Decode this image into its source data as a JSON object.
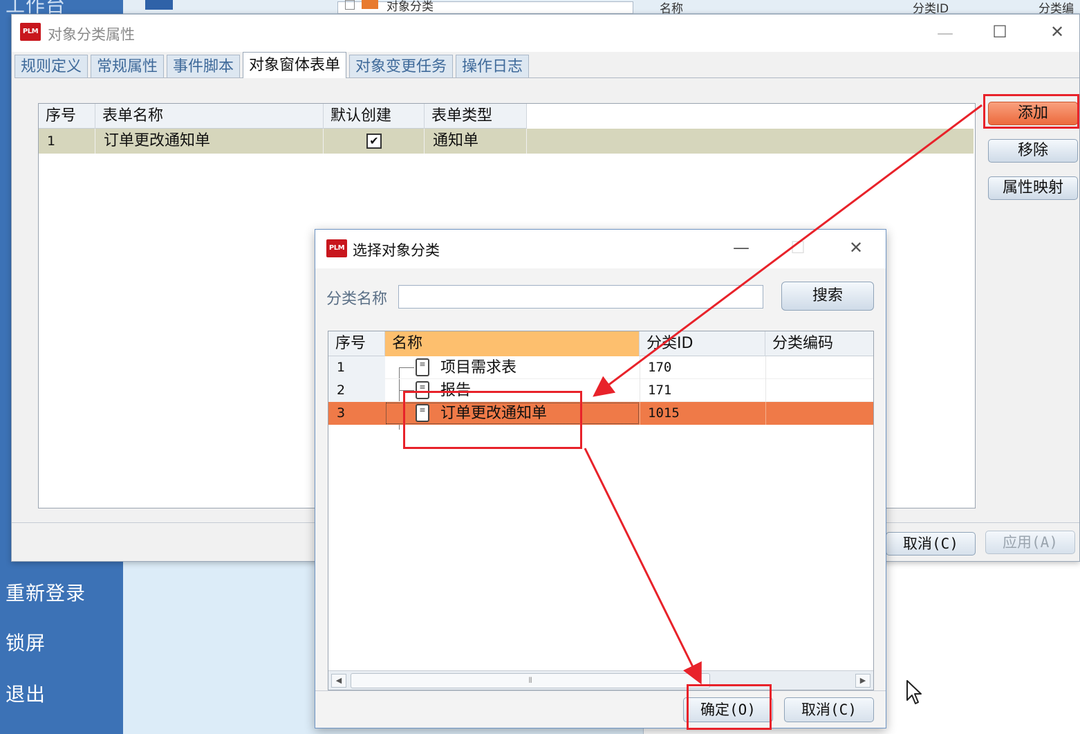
{
  "background": {
    "top_tab_title": "工作台",
    "top_panel_header": "对象分类",
    "top_grid_headers": [
      "名称",
      "分类ID",
      "分类编"
    ],
    "sidebar": [
      "重新登录",
      "锁屏",
      "退出"
    ]
  },
  "props_dialog": {
    "logo": "PLM",
    "title": "对象分类属性",
    "tabs": [
      "规则定义",
      "常规属性",
      "事件脚本",
      "对象窗体表单",
      "对象变更任务",
      "操作日志"
    ],
    "active_tab": "对象窗体表单",
    "grid": {
      "headers": [
        "序号",
        "表单名称",
        "默认创建",
        "表单类型"
      ],
      "rows": [
        {
          "seq": "1",
          "form_name": "订单更改通知单",
          "default_create": "✔",
          "form_type": "通知单"
        }
      ]
    },
    "buttons": {
      "add": "添加",
      "remove": "移除",
      "attr_map": "属性映射"
    },
    "footer": {
      "cancel": "取消(C)",
      "apply": "应用(A)"
    }
  },
  "select_dialog": {
    "logo": "PLM",
    "title": "选择对象分类",
    "search_label": "分类名称",
    "search_value": "",
    "search_button": "搜索",
    "grid": {
      "headers": [
        "序号",
        "名称",
        "分类ID",
        "分类编码"
      ],
      "rows": [
        {
          "seq": "1",
          "name": "项目需求表",
          "class_id": "170",
          "code": ""
        },
        {
          "seq": "2",
          "name": "报告",
          "class_id": "171",
          "code": ""
        },
        {
          "seq": "3",
          "name": "订单更改通知单",
          "class_id": "1015",
          "code": "",
          "selected": true
        }
      ]
    },
    "ok": "确定(O)",
    "cancel": "取消(C)"
  },
  "colors": {
    "annotation": "#e8222a",
    "selected_row": "#ef7a48",
    "sidebar": "#3c72b6",
    "sorted_header": "#fdbf6e"
  }
}
